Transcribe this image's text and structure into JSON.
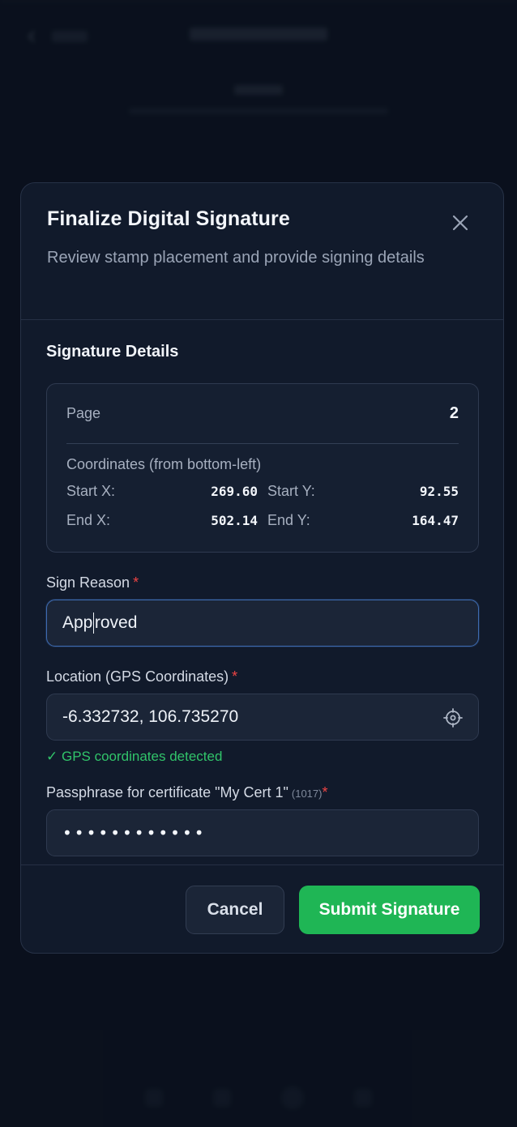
{
  "modal": {
    "title": "Finalize Digital Signature",
    "subtitle": "Review stamp placement and provide signing details",
    "close_icon": "close-icon"
  },
  "details": {
    "section_title": "Signature Details",
    "page_label": "Page",
    "page_value": "2",
    "coords_heading": "Coordinates (from bottom-left)",
    "start_x_label": "Start X:",
    "start_x_value": "269.60",
    "start_y_label": "Start Y:",
    "start_y_value": "92.55",
    "end_x_label": "End X:",
    "end_x_value": "502.14",
    "end_y_label": "End Y:",
    "end_y_value": "164.47"
  },
  "form": {
    "reason_label": "Sign Reason",
    "reason_value_before_caret": "App",
    "reason_value_after_caret": "roved",
    "location_label": "Location (GPS Coordinates)",
    "location_value": "-6.332732, 106.735270",
    "locate_icon": "crosshair-icon",
    "gps_status": "✓ GPS coordinates detected",
    "passphrase_label": "Passphrase for certificate \"My Cert 1\"",
    "passphrase_note": "(1017)",
    "passphrase_masked": "••••••••••••",
    "required_mark": "*"
  },
  "footer": {
    "cancel_label": "Cancel",
    "submit_label": "Submit Signature"
  },
  "colors": {
    "accent_green": "#1fb655",
    "status_green": "#31c46a",
    "required_red": "#ef4444",
    "focus_blue": "#3e6bb0",
    "modal_bg": "#111a2b"
  }
}
